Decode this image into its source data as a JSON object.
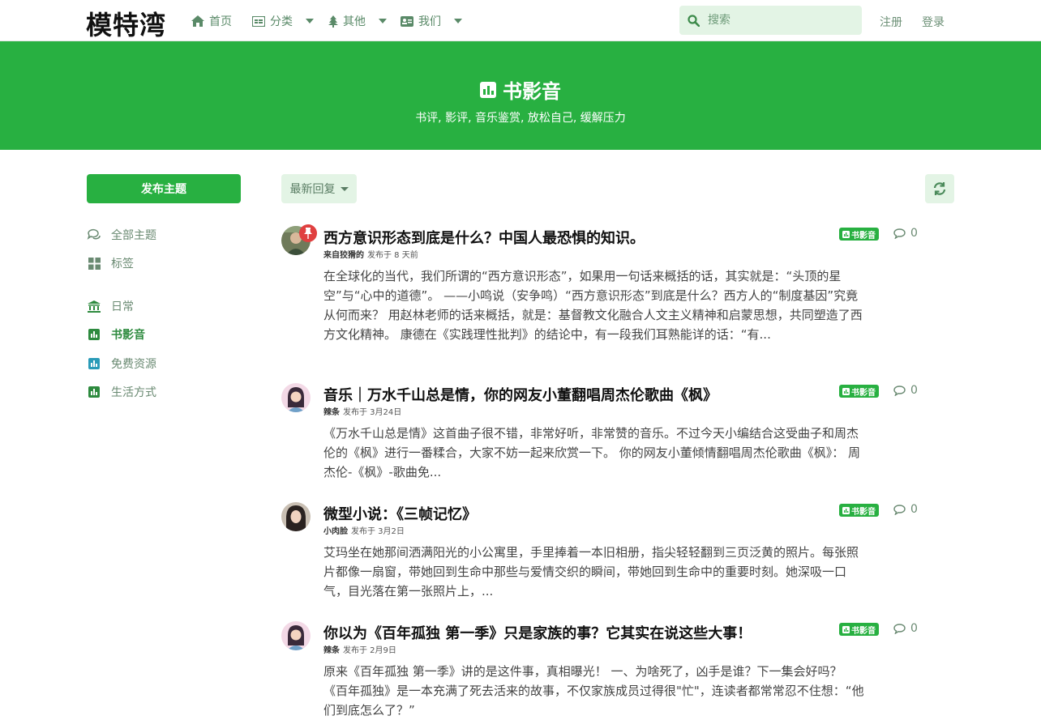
{
  "header": {
    "logo": "模特湾",
    "nav": [
      {
        "label": "首页",
        "icon": "home-icon"
      },
      {
        "label": "分类",
        "icon": "list-icon"
      },
      {
        "label": "其他",
        "icon": "tree-icon"
      },
      {
        "label": "我们",
        "icon": "id-card-icon"
      }
    ],
    "search_placeholder": "搜索",
    "register": "注册",
    "login": "登录"
  },
  "hero": {
    "title": "书影音",
    "description": "书评, 影评, 音乐鉴赏, 放松自己, 缓解压力",
    "bg_color": "#28b041"
  },
  "sidebar": {
    "publish": "发布主题",
    "items": [
      {
        "label": "全部主题",
        "icon": "comments-icon"
      },
      {
        "label": "标签",
        "icon": "grid-icon"
      },
      {
        "label": "日常",
        "icon": "bank-icon"
      },
      {
        "label": "书影音",
        "icon": "chart-icon"
      },
      {
        "label": "免费资源",
        "icon": "chart-icon"
      },
      {
        "label": "生活方式",
        "icon": "chart-icon"
      }
    ]
  },
  "toolbar": {
    "sort": "最新回复"
  },
  "posts": [
    {
      "title": "西方意识形态到底是什么？中国人最恐惧的知识。",
      "author": "来自狡猾的",
      "time": "发布于 8 天前",
      "tag": "书影音",
      "replies": "0",
      "pinned": true,
      "excerpt": "在全球化的当代，我们所谓的“西方意识形态”，如果用一句话来概括的话，其实就是：“头顶的星空”与“心中的道德”。 ——小鸣说（安争鸣）“西方意识形态”到底是什么？西方人的“制度基因”究竟从何而来？ 用赵林老师的话来概括，就是：基督教文化融合人文主义精神和启蒙思想，共同塑造了西方文化精神。 康德在《实践理性批判》的结论中，有一段我们耳熟能详的话：“有..."
    },
    {
      "title": "音乐｜万水千山总是情，你的网友小董翻唱周杰伦歌曲《枫》",
      "author": "辣条",
      "time": "发布于 3月24日",
      "tag": "书影音",
      "replies": "0",
      "pinned": false,
      "excerpt": "《万水千山总是情》这首曲子很不错，非常好听，非常赞的音乐。不过今天小编结合这受曲子和周杰伦的《枫》进行一番糅合，大家不妨一起来欣赏一下。 你的网友小董倾情翻唱周杰伦歌曲《枫》： 周杰伦-《枫》-歌曲免..."
    },
    {
      "title": "微型小说：《三帧记忆》",
      "author": "小肉脸",
      "time": "发布于 3月2日",
      "tag": "书影音",
      "replies": "0",
      "pinned": false,
      "excerpt": "艾玛坐在她那间洒满阳光的小公寓里，手里捧着一本旧相册，指尖轻轻翻到三页泛黄的照片。每张照片都像一扇窗，带她回到生命中那些与爱情交织的瞬间，带她回到生命中的重要时刻。她深吸一口气，目光落在第一张照片上，..."
    },
    {
      "title": "你以为《百年孤独 第一季》只是家族的事？它其实在说这些大事！",
      "author": "辣条",
      "time": "发布于 2月9日",
      "tag": "书影音",
      "replies": "0",
      "pinned": false,
      "excerpt": "原来《百年孤独 第一季》讲的是这件事，真相曝光！ 一、为啥死了，凶手是谁？下一集会好吗？ 《百年孤独》是一本充满了死去活来的故事，不仅家族成员过得很\"忙\"，连读者都常常忍不住想：“他们到底怎么了？”"
    }
  ]
}
